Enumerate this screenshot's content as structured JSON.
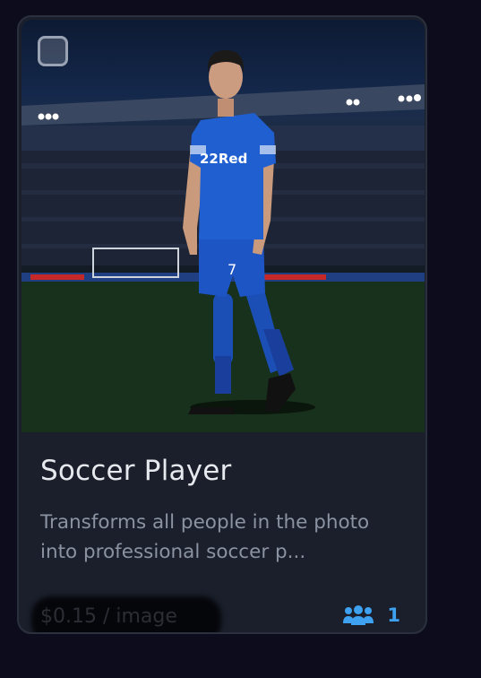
{
  "card": {
    "title": "Soccer Player",
    "description": "Transforms all people in the photo into professional soccer p...",
    "price": "$0.15",
    "price_unit": "/ image",
    "users_count": "1",
    "jersey_sponsor": "22Red",
    "jersey_number": "7"
  },
  "icons": {
    "checkbox": "checkbox-icon",
    "users": "users-icon"
  },
  "colors": {
    "accent": "#3ea2f0",
    "card_bg": "#1a1f2b",
    "page_bg": "#0d0c1c"
  }
}
